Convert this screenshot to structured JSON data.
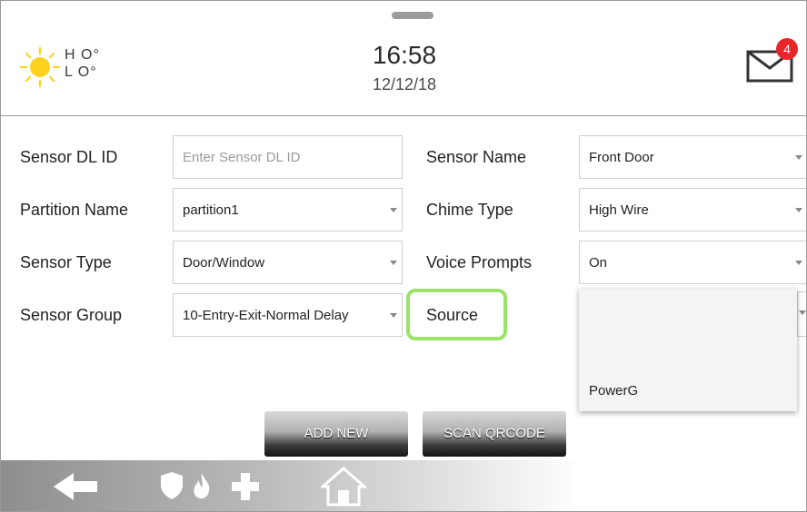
{
  "header": {
    "weather_hi": "H O°",
    "weather_lo": "L O°",
    "time": "16:58",
    "date": "12/12/18",
    "mail_count": "4"
  },
  "form": {
    "sensor_dl_id": {
      "label": "Sensor DL ID",
      "placeholder": "Enter Sensor DL ID"
    },
    "partition_name": {
      "label": "Partition Name",
      "value": "partition1"
    },
    "sensor_type": {
      "label": "Sensor Type",
      "value": "Door/Window"
    },
    "sensor_group": {
      "label": "Sensor Group",
      "value": "10-Entry-Exit-Normal Delay"
    },
    "sensor_name": {
      "label": "Sensor Name",
      "value": "Front Door"
    },
    "chime_type": {
      "label": "Chime Type",
      "value": "High Wire"
    },
    "voice_prompts": {
      "label": "Voice Prompts",
      "value": "On"
    },
    "source": {
      "label": "Source",
      "options": [
        "PowerG"
      ]
    }
  },
  "buttons": {
    "add_new": "ADD NEW",
    "scan_qrcode": "SCAN QRCODE"
  },
  "colors": {
    "highlight": "#9be26a",
    "badge": "#e8262a",
    "sun": "#ffd21f"
  },
  "icons": [
    "sun-icon",
    "mail-icon",
    "back-arrow-icon",
    "shield-icon",
    "fire-icon",
    "medical-cross-icon",
    "home-icon"
  ]
}
